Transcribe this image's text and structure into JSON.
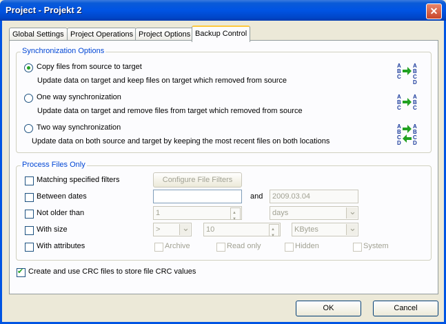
{
  "window": {
    "title": "Project - Projekt 2",
    "close_glyph": "✕"
  },
  "tabs": [
    {
      "label": "Global Settings"
    },
    {
      "label": "Project Operations"
    },
    {
      "label": "Project Options"
    },
    {
      "label": "Backup Control",
      "active": true
    }
  ],
  "sync": {
    "legend": "Synchronization Options",
    "options": [
      {
        "label": "Copy files from source to target",
        "description": "Update data on target and keep files on target which removed from source",
        "selected": true,
        "icon": "copy-sync-icon"
      },
      {
        "label": "One way synchronization",
        "description": "Update data on target and remove files from target which removed from source",
        "selected": false,
        "icon": "one-way-sync-icon"
      },
      {
        "label": "Two way synchronization",
        "description": "Update data on both source and target by keeping the most recent files on both locations",
        "selected": false,
        "icon": "two-way-sync-icon"
      }
    ],
    "icon_letters": {
      "a": "A",
      "b": "B",
      "c": "C",
      "d": "D"
    }
  },
  "process": {
    "legend": "Process Files Only",
    "matching_filters": {
      "label": "Matching specified filters",
      "checked": false,
      "button": "Configure File Filters"
    },
    "between_dates": {
      "label": "Between dates",
      "checked": false,
      "from": "",
      "and_label": "and",
      "to": "2009.03.04"
    },
    "not_older": {
      "label": "Not older than",
      "checked": false,
      "value": "1",
      "unit": "days"
    },
    "with_size": {
      "label": "With size",
      "checked": false,
      "operator": ">",
      "value": "10",
      "unit": "KBytes"
    },
    "with_attributes": {
      "label": "With attributes",
      "checked": false,
      "attributes": [
        "Archive",
        "Read only",
        "Hidden",
        "System"
      ]
    }
  },
  "crc": {
    "label": "Create and use CRC files to store file CRC values",
    "checked": true
  },
  "buttons": {
    "ok": "OK",
    "cancel": "Cancel"
  },
  "colors": {
    "accent": "#0046d5",
    "check": "#21a121",
    "titlebar": "#0054e3",
    "arrow": "#21a121"
  }
}
